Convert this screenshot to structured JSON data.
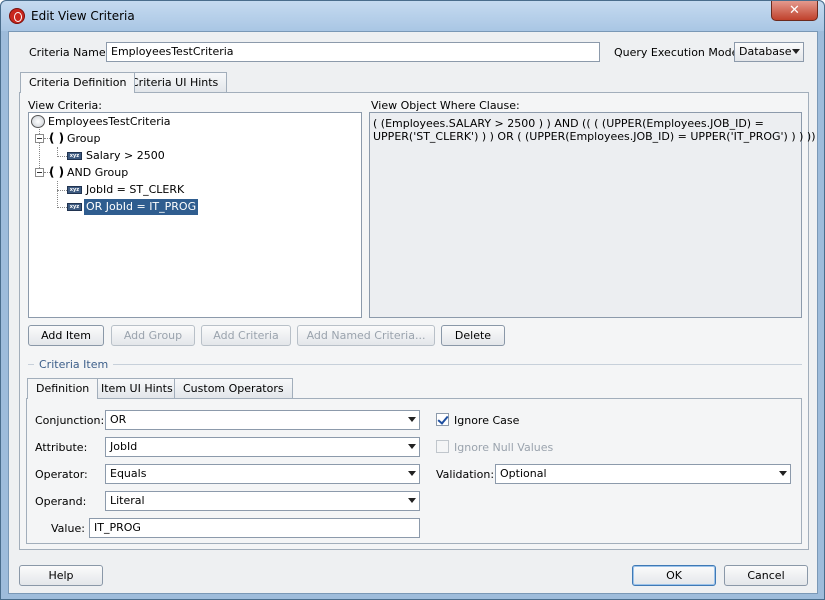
{
  "window": {
    "title": "Edit View Criteria",
    "close_glyph": "✕"
  },
  "criteria_name": {
    "label": "Criteria Name:",
    "value": "EmployeesTestCriteria"
  },
  "query_execution_mode": {
    "label": "Query Execution Mode:",
    "value": "Database"
  },
  "top_tabs": [
    {
      "label": "Criteria Definition"
    },
    {
      "label": "Criteria UI Hints"
    }
  ],
  "view_criteria": {
    "label": "View Criteria:",
    "root": "EmployeesTestCriteria",
    "items": [
      {
        "text": "Group",
        "kind": "group"
      },
      {
        "text": "Salary > 2500",
        "kind": "item"
      },
      {
        "text": "AND Group",
        "kind": "group"
      },
      {
        "text": "JobId = ST_CLERK",
        "kind": "item"
      },
      {
        "text": "OR JobId = IT_PROG",
        "kind": "item",
        "selected": true
      }
    ],
    "icon_text": "xyz"
  },
  "where_clause": {
    "label": "View Object Where Clause:",
    "line1": "( (Employees.SALARY > 2500 ) )  AND ((  ( (UPPER(Employees.JOB_ID) =",
    "line2": "UPPER('ST_CLERK') ) )  OR ( (UPPER(Employees.JOB_ID) = UPPER('IT_PROG') ) )  ))"
  },
  "actions": {
    "add_item": "Add Item",
    "add_group": "Add Group",
    "add_criteria": "Add Criteria",
    "add_named_criteria": "Add Named Criteria...",
    "delete": "Delete"
  },
  "criteria_item": {
    "section_label": "Criteria Item",
    "tabs": [
      {
        "label": "Definition"
      },
      {
        "label": "Item UI Hints"
      },
      {
        "label": "Custom Operators"
      }
    ],
    "conjunction": {
      "label": "Conjunction:",
      "value": "OR"
    },
    "attribute": {
      "label": "Attribute:",
      "value": "JobId"
    },
    "operator": {
      "label": "Operator:",
      "value": "Equals"
    },
    "operand": {
      "label": "Operand:",
      "value": "Literal"
    },
    "value": {
      "label": "Value:",
      "value": "IT_PROG"
    },
    "ignore_case": {
      "label": "Ignore Case",
      "checked": true
    },
    "ignore_null": {
      "label": "Ignore Null Values",
      "checked": false,
      "disabled": true
    },
    "validation": {
      "label": "Validation:",
      "value": "Optional"
    }
  },
  "footer": {
    "help": "Help",
    "ok": "OK",
    "cancel": "Cancel"
  },
  "colors": {
    "selection": "#2f5d8f",
    "frame": "#9ebcdb",
    "section_title": "#3d5f8a"
  }
}
